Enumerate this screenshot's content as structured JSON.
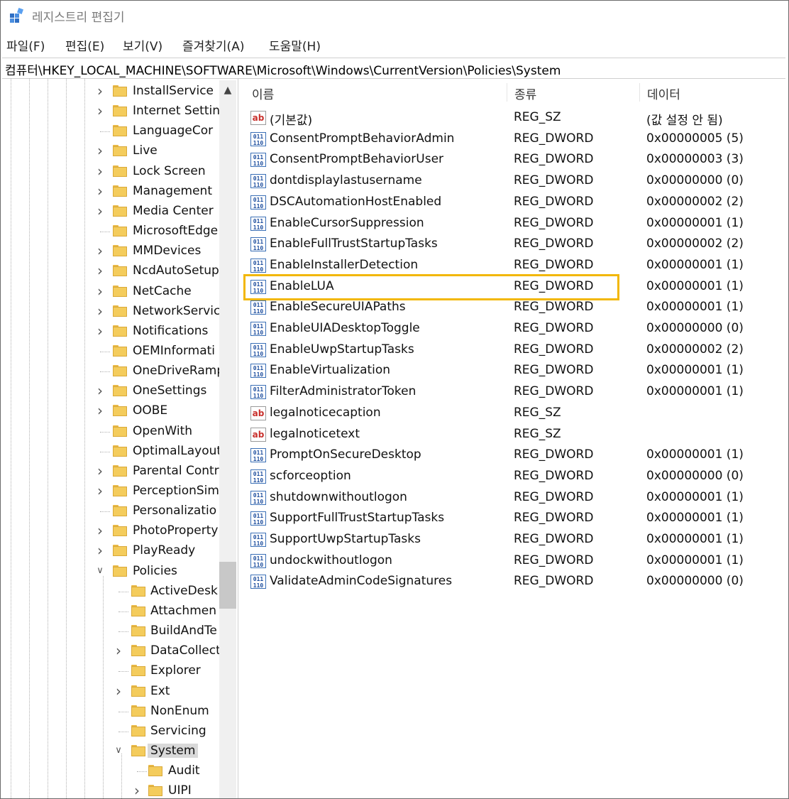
{
  "window": {
    "title": "레지스트리 편집기"
  },
  "menu": [
    "파일(F)",
    "편집(E)",
    "보기(V)",
    "즐겨찾기(A)",
    "도움말(H)"
  ],
  "address": "컴퓨터\\HKEY_LOCAL_MACHINE\\SOFTWARE\\Microsoft\\Windows\\CurrentVersion\\Policies\\System",
  "tree": [
    {
      "label": "InstallService",
      "expander": "collapsed",
      "level": 0
    },
    {
      "label": "Internet Settin",
      "expander": "collapsed",
      "level": 0
    },
    {
      "label": "LanguageCor",
      "expander": "none",
      "level": 0
    },
    {
      "label": "Live",
      "expander": "collapsed",
      "level": 0
    },
    {
      "label": "Lock Screen",
      "expander": "collapsed",
      "level": 0
    },
    {
      "label": "Management",
      "expander": "collapsed",
      "level": 0
    },
    {
      "label": "Media Center",
      "expander": "collapsed",
      "level": 0
    },
    {
      "label": "MicrosoftEdge",
      "expander": "none",
      "level": 0
    },
    {
      "label": "MMDevices",
      "expander": "collapsed",
      "level": 0
    },
    {
      "label": "NcdAutoSetup",
      "expander": "collapsed",
      "level": 0
    },
    {
      "label": "NetCache",
      "expander": "collapsed",
      "level": 0
    },
    {
      "label": "NetworkServic",
      "expander": "collapsed",
      "level": 0
    },
    {
      "label": "Notifications",
      "expander": "collapsed",
      "level": 0
    },
    {
      "label": "OEMInformati",
      "expander": "none",
      "level": 0
    },
    {
      "label": "OneDriveRamp",
      "expander": "none",
      "level": 0
    },
    {
      "label": "OneSettings",
      "expander": "collapsed",
      "level": 0
    },
    {
      "label": "OOBE",
      "expander": "collapsed",
      "level": 0
    },
    {
      "label": "OpenWith",
      "expander": "none",
      "level": 0
    },
    {
      "label": "OptimalLayout",
      "expander": "none",
      "level": 0
    },
    {
      "label": "Parental Contr",
      "expander": "collapsed",
      "level": 0
    },
    {
      "label": "PerceptionSim",
      "expander": "collapsed",
      "level": 0
    },
    {
      "label": "Personalizatio",
      "expander": "none",
      "level": 0
    },
    {
      "label": "PhotoProperty",
      "expander": "collapsed",
      "level": 0
    },
    {
      "label": "PlayReady",
      "expander": "collapsed",
      "level": 0
    },
    {
      "label": "Policies",
      "expander": "expanded",
      "level": 0
    },
    {
      "label": "ActiveDesk",
      "expander": "none",
      "level": 1
    },
    {
      "label": "Attachmen",
      "expander": "none",
      "level": 1
    },
    {
      "label": "BuildAndTe",
      "expander": "none",
      "level": 1
    },
    {
      "label": "DataCollect",
      "expander": "collapsed",
      "level": 1
    },
    {
      "label": "Explorer",
      "expander": "none",
      "level": 1
    },
    {
      "label": "Ext",
      "expander": "collapsed",
      "level": 1
    },
    {
      "label": "NonEnum",
      "expander": "none",
      "level": 1
    },
    {
      "label": "Servicing",
      "expander": "none",
      "level": 1
    },
    {
      "label": "System",
      "expander": "expanded",
      "level": 1,
      "selected": true
    },
    {
      "label": "Audit",
      "expander": "none",
      "level": 2
    },
    {
      "label": "UIPI",
      "expander": "collapsed",
      "level": 2
    }
  ],
  "list": {
    "headers": {
      "name": "이름",
      "type": "종류",
      "data": "데이터"
    },
    "rows": [
      {
        "name": "(기본값)",
        "type": "REG_SZ",
        "data": "(값 설정 안 됨)",
        "icon": "ab"
      },
      {
        "name": "ConsentPromptBehaviorAdmin",
        "type": "REG_DWORD",
        "data": "0x00000005 (5)",
        "icon": "bin"
      },
      {
        "name": "ConsentPromptBehaviorUser",
        "type": "REG_DWORD",
        "data": "0x00000003 (3)",
        "icon": "bin"
      },
      {
        "name": "dontdisplaylastusername",
        "type": "REG_DWORD",
        "data": "0x00000000 (0)",
        "icon": "bin"
      },
      {
        "name": "DSCAutomationHostEnabled",
        "type": "REG_DWORD",
        "data": "0x00000002 (2)",
        "icon": "bin"
      },
      {
        "name": "EnableCursorSuppression",
        "type": "REG_DWORD",
        "data": "0x00000001 (1)",
        "icon": "bin"
      },
      {
        "name": "EnableFullTrustStartupTasks",
        "type": "REG_DWORD",
        "data": "0x00000002 (2)",
        "icon": "bin"
      },
      {
        "name": "EnableInstallerDetection",
        "type": "REG_DWORD",
        "data": "0x00000001 (1)",
        "icon": "bin"
      },
      {
        "name": "EnableLUA",
        "type": "REG_DWORD",
        "data": "0x00000001 (1)",
        "icon": "bin",
        "highlighted": true
      },
      {
        "name": "EnableSecureUIAPaths",
        "type": "REG_DWORD",
        "data": "0x00000001 (1)",
        "icon": "bin"
      },
      {
        "name": "EnableUIADesktopToggle",
        "type": "REG_DWORD",
        "data": "0x00000000 (0)",
        "icon": "bin"
      },
      {
        "name": "EnableUwpStartupTasks",
        "type": "REG_DWORD",
        "data": "0x00000002 (2)",
        "icon": "bin"
      },
      {
        "name": "EnableVirtualization",
        "type": "REG_DWORD",
        "data": "0x00000001 (1)",
        "icon": "bin"
      },
      {
        "name": "FilterAdministratorToken",
        "type": "REG_DWORD",
        "data": "0x00000001 (1)",
        "icon": "bin"
      },
      {
        "name": "legalnoticecaption",
        "type": "REG_SZ",
        "data": "",
        "icon": "ab"
      },
      {
        "name": "legalnoticetext",
        "type": "REG_SZ",
        "data": "",
        "icon": "ab"
      },
      {
        "name": "PromptOnSecureDesktop",
        "type": "REG_DWORD",
        "data": "0x00000001 (1)",
        "icon": "bin"
      },
      {
        "name": "scforceoption",
        "type": "REG_DWORD",
        "data": "0x00000000 (0)",
        "icon": "bin"
      },
      {
        "name": "shutdownwithoutlogon",
        "type": "REG_DWORD",
        "data": "0x00000001 (1)",
        "icon": "bin"
      },
      {
        "name": "SupportFullTrustStartupTasks",
        "type": "REG_DWORD",
        "data": "0x00000001 (1)",
        "icon": "bin"
      },
      {
        "name": "SupportUwpStartupTasks",
        "type": "REG_DWORD",
        "data": "0x00000001 (1)",
        "icon": "bin"
      },
      {
        "name": "undockwithoutlogon",
        "type": "REG_DWORD",
        "data": "0x00000001 (1)",
        "icon": "bin"
      },
      {
        "name": "ValidateAdminCodeSignatures",
        "type": "REG_DWORD",
        "data": "0x00000000 (0)",
        "icon": "bin"
      }
    ]
  },
  "highlight_color": "#f2b705"
}
